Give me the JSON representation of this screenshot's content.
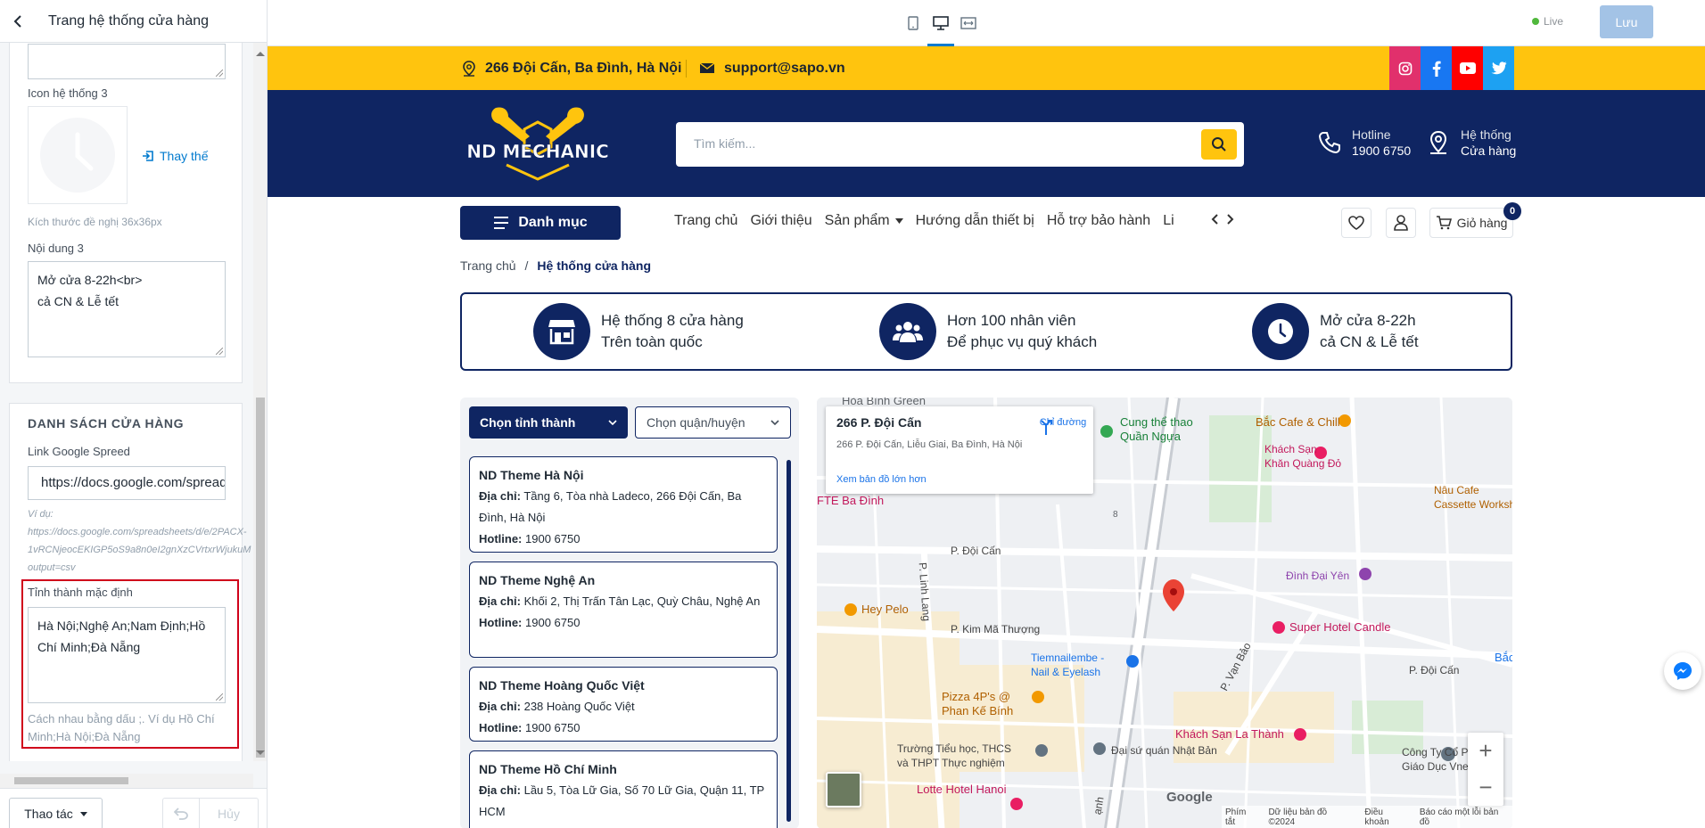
{
  "panel": {
    "title": "Trang hệ thống cửa hàng",
    "icon3": {
      "label": "Icon hệ thống 3",
      "replace": "Thay thế",
      "size_hint": "Kích thước đề nghị 36x36px"
    },
    "content3": {
      "label": "Nội dung 3",
      "value": "Mở cửa 8-22h<br>\ncả CN & Lễ tết"
    },
    "store_list": {
      "section_title": "DANH SÁCH CỬA HÀNG",
      "link_label": "Link Google Spreed",
      "link_value": "https://docs.google.com/spreadsheets",
      "example_line1": "Ví dụ:",
      "example_line2": "https://docs.google.com/spreadsheets/d/e/2PACX-",
      "example_line3": "1vRCNjeocEKIGP5oS9a8n0eI2gnXzCVrtxrWjukuM",
      "example_line4": "output=csv",
      "default_label": "Tỉnh thành mặc định",
      "default_value": "Hà Nội;Nghệ An;Nam Định;Hồ Chí Minh;Đà Nẵng",
      "default_hint": "Cách nhau bằng dấu ;. Ví dụ Hồ Chí Minh;Hà Nội;Đà Nẵng"
    },
    "footer": {
      "actions": "Thao tác",
      "cancel": "Hủy"
    }
  },
  "editor": {
    "live": "Live",
    "save": "Lưu"
  },
  "site": {
    "address": "266 Đội Cấn, Ba Đình, Hà Nội",
    "email": "support@sapo.vn",
    "logo_text": "ND MECHANIC",
    "search_placeholder": "Tìm kiếm...",
    "hotline_label": "Hotline",
    "hotline_value": "1900 6750",
    "system_label": "Hệ thống",
    "system_value": "Cửa hàng",
    "menu_button": "Danh mục",
    "nav": [
      "Trang chủ",
      "Giới thiệu",
      "Sản phẩm",
      "Hướng dẫn thiết bị",
      "Hỗ trợ bảo hành",
      "Liên hệ"
    ],
    "cart_label": "Giỏ hàng",
    "cart_count": "0",
    "breadcrumb_home": "Trang chủ",
    "breadcrumb_sep": "/",
    "breadcrumb_current": "Hệ thống cửa hàng",
    "features": [
      {
        "line1": "Hệ thống 8 cửa hàng",
        "line2": "Trên toàn quốc"
      },
      {
        "line1": "Hơn 100 nhân viên",
        "line2": "Để phục vụ quý khách"
      },
      {
        "line1": "Mở cửa 8-22h",
        "line2": "cả CN & Lễ tết"
      }
    ],
    "select_province": "Chọn tỉnh thành",
    "select_district": "Chọn quận/huyện",
    "address_label": "Địa chỉ:",
    "hotline_row_label": "Hotline:",
    "stores": [
      {
        "name": "ND Theme Hà Nội",
        "address": "Tầng 6, Tòa nhà Ladeco, 266 Đội Cấn, Ba Đình, Hà Nội",
        "hotline": "1900 6750"
      },
      {
        "name": "ND Theme Nghệ An",
        "address": "Khối 2, Thị Trấn Tân Lạc, Quỳ Châu, Nghệ An",
        "hotline": "1900 6750"
      },
      {
        "name": "ND Theme Hoàng Quốc Việt",
        "address": "238 Hoàng Quốc Việt",
        "hotline": "1900 6750"
      },
      {
        "name": "ND Theme Hồ Chí Minh",
        "address": "Lầu 5, Tòa Lữ Gia, Số 70 Lữ Gia, Quận 11, TP HCM",
        "hotline": ""
      }
    ]
  },
  "map": {
    "place_title": "266 P. Đội Cấn",
    "place_address": "266 P. Đội Cấn, Liễu Giai, Ba Đình, Hà Nội",
    "directions": "Chỉ đường",
    "bigger_map": "Xem bản đồ lớn hơn",
    "pois": {
      "hoa_binh_green": "Hòa Bình Green",
      "cung_the_thao_1": "Cung thể thao",
      "cung_the_thao_2": "Quần Ngựa",
      "bac_cafe": "Bắc Cafe & Chill",
      "khach_san_khan_1": "Khách Sạn",
      "khach_san_khan_2": "Khăn Quàng Đỏ",
      "fte": "FTE Ba Đình",
      "nau_cafe_1": "Nâu Cafe",
      "nau_cafe_2": "Cassette Worksh",
      "p_doi_can_1": "P. Đội Cấn",
      "dinh_dai_yen": "Đình Đại Yên",
      "hey_pelo": "Hey Pelo",
      "p_linh_lang": "P. Linh Lang",
      "p_kim_ma": "P. Kim Mã Thượng",
      "super_hotel": "Super Hotel Candle",
      "tiemnail_1": "Tiemnailembe -",
      "tiemnail_2": "Nail & Eyelash",
      "p_van_bao": "P. Vạn Bảo",
      "p_doi_can_2": "P. Đội Cấn",
      "bac": "Bắc",
      "pizza_1": "Pizza 4P's @",
      "pizza_2": "Phan Kế Bính",
      "khach_san_la_thanh": "Khách Sạn La Thành",
      "truong_1": "Trường Tiểu học, THCS",
      "truong_2": "và THPT Thực nghiệm",
      "dai_su_quan": "Đại sứ quán Nhật Bản",
      "cong_ty_1": "Công Ty Cổ Phần",
      "cong_ty_2": "Giáo Dục Vnes",
      "lotte": "Lotte Hotel Hanoi",
      "num8": "8",
      "anh": "ạnh"
    },
    "google": "Google",
    "footer": [
      "Phím tắt",
      "Dữ liệu bản đồ ©2024",
      "Điều khoản",
      "Báo cáo một lỗi bản đồ"
    ]
  },
  "colors": {
    "brand_navy": "#0f2562",
    "brand_yellow": "#ffc40e",
    "highlight_red": "#d0021b"
  }
}
